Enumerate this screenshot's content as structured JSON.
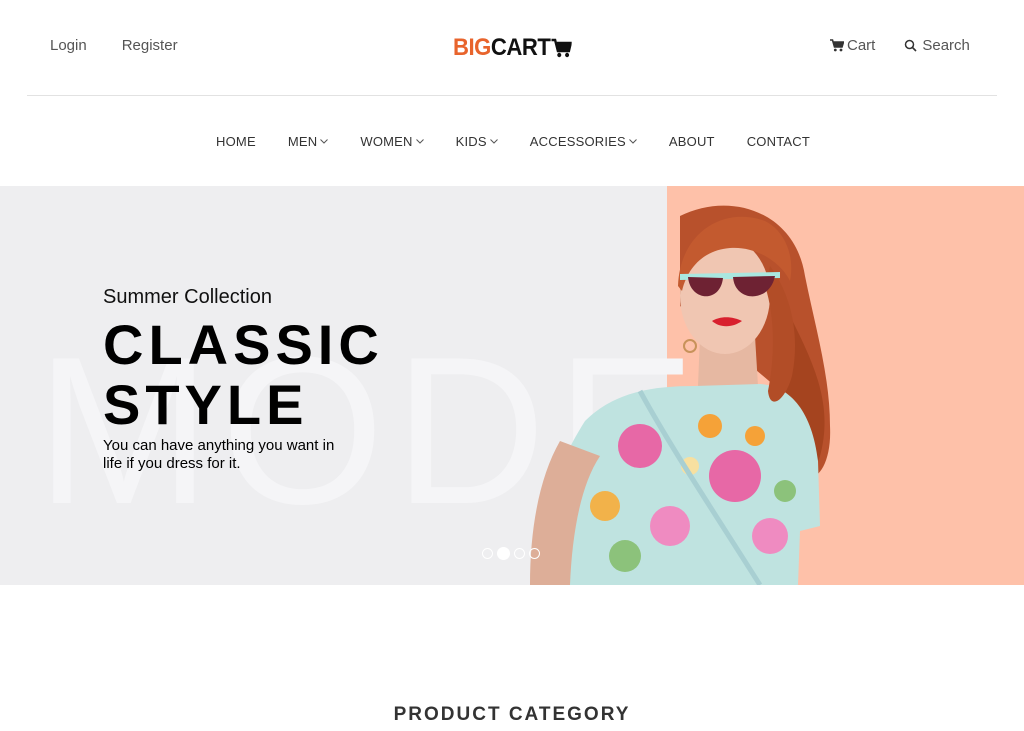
{
  "header": {
    "login_label": "Login",
    "register_label": "Register",
    "logo_big": "BIG",
    "logo_cart": "CART",
    "cart_label": "Cart",
    "search_label": "Search",
    "icons": {
      "cart": "cart-icon",
      "search": "search-icon"
    }
  },
  "nav": {
    "items": [
      {
        "label": "HOME",
        "dropdown": false
      },
      {
        "label": "MEN",
        "dropdown": true
      },
      {
        "label": "WOMEN",
        "dropdown": true
      },
      {
        "label": "KIDS",
        "dropdown": true
      },
      {
        "label": "ACCESSORIES",
        "dropdown": true
      },
      {
        "label": "ABOUT",
        "dropdown": false
      },
      {
        "label": "CONTACT",
        "dropdown": false
      }
    ]
  },
  "hero": {
    "subtitle": "Summer Collection",
    "headline_line1": "CLASSIC",
    "headline_line2": "STYLE",
    "description": "You can have anything you want in life if you dress for it.",
    "watermark": "MODE",
    "slides": {
      "count": 4,
      "active_index": 1
    }
  },
  "section": {
    "title": "PRODUCT CATEGORY"
  },
  "colors": {
    "brand_orange": "#e8642c",
    "hero_bg": "#eeeef0",
    "hero_accent_bg": "#fec1a9"
  }
}
